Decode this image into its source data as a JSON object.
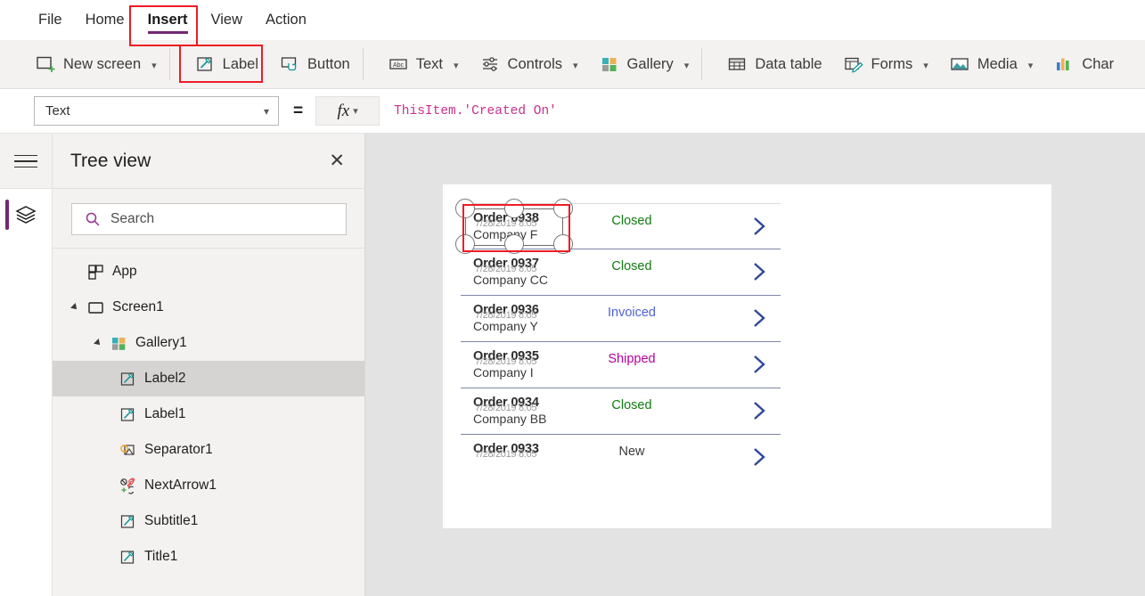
{
  "menu": {
    "items": [
      {
        "label": "File",
        "active": false
      },
      {
        "label": "Home",
        "active": false
      },
      {
        "label": "Insert",
        "active": true
      },
      {
        "label": "View",
        "active": false
      },
      {
        "label": "Action",
        "active": false
      }
    ]
  },
  "ribbon": {
    "items": [
      {
        "label": "New screen",
        "icon": "new-screen-icon",
        "caret": true
      },
      {
        "label": "Label",
        "icon": "label-icon",
        "caret": false
      },
      {
        "label": "Button",
        "icon": "button-icon",
        "caret": false
      },
      {
        "label": "Text",
        "icon": "text-abc-icon",
        "caret": true
      },
      {
        "label": "Controls",
        "icon": "controls-sliders-icon",
        "caret": true
      },
      {
        "label": "Gallery",
        "icon": "gallery-grid-icon",
        "caret": true
      },
      {
        "label": "Data table",
        "icon": "data-table-icon",
        "caret": false
      },
      {
        "label": "Forms",
        "icon": "forms-icon",
        "caret": true
      },
      {
        "label": "Media",
        "icon": "media-image-icon",
        "caret": true
      },
      {
        "label": "Char",
        "icon": "charts-icon",
        "caret": false
      }
    ]
  },
  "formula_bar": {
    "property": "Text",
    "equals": "=",
    "fx": "fx",
    "expression_ident": "ThisItem",
    "expression_rest": ".'Created On'"
  },
  "tree_view": {
    "title": "Tree view",
    "close_label": "✕",
    "search_placeholder": "Search",
    "nodes": [
      {
        "label": "App",
        "icon": "app-icon",
        "indent": 1,
        "twisty": false,
        "selected": false
      },
      {
        "label": "Screen1",
        "icon": "screen-icon",
        "indent": 1,
        "twisty": true,
        "selected": false
      },
      {
        "label": "Gallery1",
        "icon": "gallery-icon",
        "indent": 2,
        "twisty": true,
        "selected": false
      },
      {
        "label": "Label2",
        "icon": "label-icon",
        "indent": 3,
        "twisty": false,
        "selected": true
      },
      {
        "label": "Label1",
        "icon": "label-icon",
        "indent": 3,
        "twisty": false,
        "selected": false
      },
      {
        "label": "Separator1",
        "icon": "separator-icon",
        "indent": 3,
        "twisty": false,
        "selected": false
      },
      {
        "label": "NextArrow1",
        "icon": "nextarrow-icon",
        "indent": 3,
        "twisty": false,
        "selected": false
      },
      {
        "label": "Subtitle1",
        "icon": "label-icon",
        "indent": 3,
        "twisty": false,
        "selected": false
      },
      {
        "label": "Title1",
        "icon": "label-icon",
        "indent": 3,
        "twisty": false,
        "selected": false
      }
    ]
  },
  "canvas": {
    "gallery_rows": [
      {
        "title": "Order 0938",
        "subtitle": "Company F",
        "overlay": "7/28/2019 8:05",
        "status": "Closed",
        "status_color": "#107c10",
        "selected": true
      },
      {
        "title": "Order 0937",
        "subtitle": "Company CC",
        "overlay": "7/28/2019 8:05",
        "status": "Closed",
        "status_color": "#107c10",
        "selected": false
      },
      {
        "title": "Order 0936",
        "subtitle": "Company Y",
        "overlay": "7/28/2019 8:05",
        "status": "Invoiced",
        "status_color": "#4f63d2",
        "selected": false
      },
      {
        "title": "Order 0935",
        "subtitle": "Company I",
        "overlay": "7/28/2019 8:05",
        "status": "Shipped",
        "status_color": "#b4009e",
        "selected": false
      },
      {
        "title": "Order 0934",
        "subtitle": "Company BB",
        "overlay": "7/28/2019 8:05",
        "status": "Closed",
        "status_color": "#107c10",
        "selected": false
      },
      {
        "title": "Order 0933",
        "subtitle": "",
        "overlay": "7/28/2019 8:05",
        "status": "New",
        "status_color": "#3b3a39",
        "selected": false
      }
    ]
  },
  "colors": {
    "accent_purple": "#742774",
    "annotation_red": "#ee1c25",
    "selection_red": "#e81123",
    "chevron_navy": "#31479b"
  }
}
